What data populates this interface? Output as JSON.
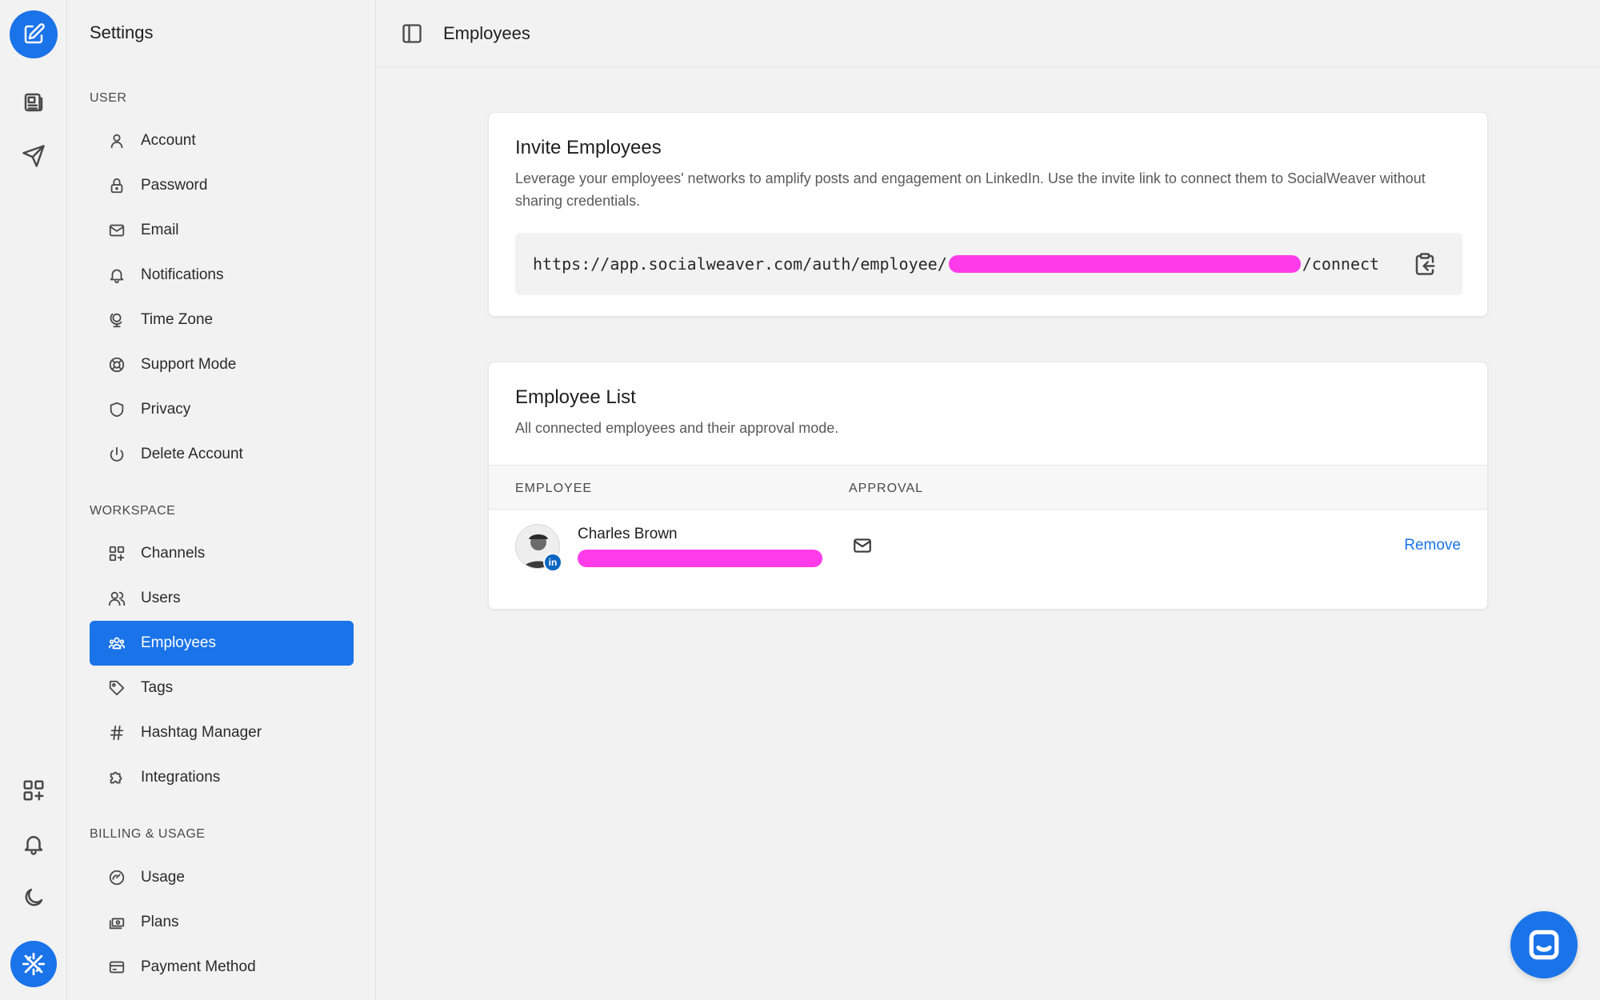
{
  "rail": {
    "top_icons": [
      "edit-icon",
      "newspaper-icon",
      "send-icon"
    ],
    "bottom_icons": [
      "apps-add-icon",
      "bell-icon",
      "moon-icon",
      "logo-icon"
    ]
  },
  "sidebar": {
    "title": "Settings",
    "sections": [
      {
        "label": "USER",
        "items": [
          {
            "label": "Account",
            "icon": "user-icon"
          },
          {
            "label": "Password",
            "icon": "lock-icon"
          },
          {
            "label": "Email",
            "icon": "mail-icon"
          },
          {
            "label": "Notifications",
            "icon": "bell-icon"
          },
          {
            "label": "Time Zone",
            "icon": "globe-stand-icon"
          },
          {
            "label": "Support Mode",
            "icon": "lifebuoy-icon"
          },
          {
            "label": "Privacy",
            "icon": "shield-icon"
          },
          {
            "label": "Delete Account",
            "icon": "power-icon"
          }
        ]
      },
      {
        "label": "WORKSPACE",
        "items": [
          {
            "label": "Channels",
            "icon": "apps-add-icon"
          },
          {
            "label": "Users",
            "icon": "users-icon"
          },
          {
            "label": "Employees",
            "icon": "team-icon",
            "active": true
          },
          {
            "label": "Tags",
            "icon": "tag-icon"
          },
          {
            "label": "Hashtag Manager",
            "icon": "hashtag-icon"
          },
          {
            "label": "Integrations",
            "icon": "puzzle-icon"
          }
        ]
      },
      {
        "label": "BILLING & USAGE",
        "items": [
          {
            "label": "Usage",
            "icon": "gauge-icon"
          },
          {
            "label": "Plans",
            "icon": "money-icon"
          },
          {
            "label": "Payment Method",
            "icon": "credit-card-icon"
          }
        ]
      }
    ]
  },
  "header": {
    "title": "Employees"
  },
  "invite": {
    "title": "Invite Employees",
    "description": "Leverage your employees' networks to amplify posts and engagement on LinkedIn. Use the invite link to connect them to SocialWeaver without sharing credentials.",
    "link_prefix": "https://app.socialweaver.com/auth/employee/",
    "link_suffix": "/connect"
  },
  "employee_list": {
    "title": "Employee List",
    "description": "All connected employees and their approval mode.",
    "columns": [
      "EMPLOYEE",
      "APPROVAL"
    ],
    "rows": [
      {
        "name": "Charles Brown",
        "network_badge": "in",
        "approval_icon": "mail-icon",
        "action": "Remove"
      }
    ]
  },
  "colors": {
    "accent": "#1a73e8",
    "redaction": "#ff3bea",
    "linkedin": "#0a66c2"
  }
}
